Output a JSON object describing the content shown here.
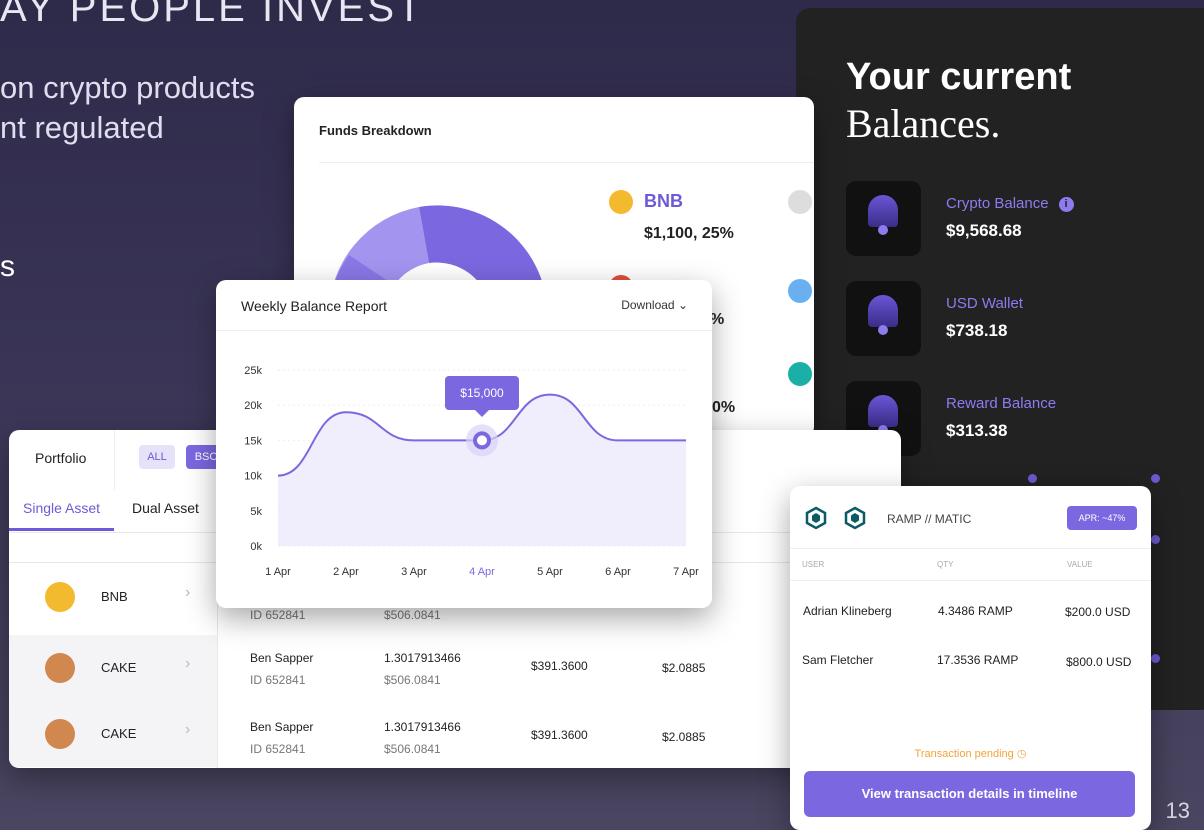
{
  "background": {
    "headline": "AY PEOPLE INVEST",
    "line1": "on crypto products",
    "line2": "nt regulated",
    "fragment": "s",
    "page_number": "13"
  },
  "balances": {
    "title_line1": "Your current",
    "title_line2": "Balances.",
    "items": [
      {
        "label": "Crypto Balance",
        "value": "$9,568.68",
        "info": "i"
      },
      {
        "label": "USD Wallet",
        "value": "$738.18"
      },
      {
        "label": "Reward Balance",
        "value": "$313.38"
      }
    ],
    "accent_color": "#8d7cf0"
  },
  "funds": {
    "title": "Funds Breakdown",
    "bnb_name": "BNB",
    "bnb_value": "$1,100, 25%",
    "fragment_pct1": "%",
    "fragment_pct2": "0%"
  },
  "weekly": {
    "title": "Weekly Balance Report",
    "download_label": "Download",
    "tooltip": "$15,000"
  },
  "chart_data": {
    "type": "area",
    "title": "Weekly Balance Report",
    "x": [
      "1 Apr",
      "2 Apr",
      "3 Apr",
      "4 Apr",
      "5 Apr",
      "6 Apr",
      "7 Apr"
    ],
    "y_ticks": [
      "25k",
      "20k",
      "15k",
      "10k",
      "5k",
      "0k"
    ],
    "ylim": [
      0,
      25000
    ],
    "series": [
      {
        "values": [
          10000,
          19000,
          15000,
          15000,
          21500,
          15000,
          15000
        ]
      }
    ],
    "highlight": {
      "x": "4 Apr",
      "label": "$15,000"
    },
    "color": "#7b68e0"
  },
  "portfolio": {
    "title": "Portfolio",
    "chips": [
      "ALL",
      "BSC"
    ],
    "tabs": [
      "Single Asset",
      "Dual Asset"
    ],
    "assets": [
      {
        "name": "BNB"
      },
      {
        "name": "CAKE"
      },
      {
        "name": "CAKE"
      }
    ],
    "rows": [
      {
        "user": "",
        "id": "ID 652841",
        "qty": "",
        "qty_sub": "$506.0841",
        "price": "",
        "change": ""
      },
      {
        "user": "Ben Sapper",
        "id": "ID 652841",
        "qty": "1.3017913466",
        "qty_sub": "$506.0841",
        "price": "$391.3600",
        "change": "$2.0885"
      },
      {
        "user": "Ben Sapper",
        "id": "ID 652841",
        "qty": "1.3017913466",
        "qty_sub": "$506.0841",
        "price": "$391.3600",
        "change": "$2.0885"
      }
    ]
  },
  "ramp": {
    "pair": "RAMP //  MATIC",
    "apr": "APR: ~47%",
    "headers": [
      "USER",
      "QTY",
      "VALUE"
    ],
    "rows": [
      {
        "user": "Adrian Klineberg",
        "qty": "4.3486 RAMP",
        "value": "$200.0 USD"
      },
      {
        "user": "Sam Fletcher",
        "qty": "17.3536 RAMP",
        "value": "$800.0 USD"
      }
    ],
    "pending": "Transaction pending",
    "cta": "View transaction details in timeline"
  }
}
